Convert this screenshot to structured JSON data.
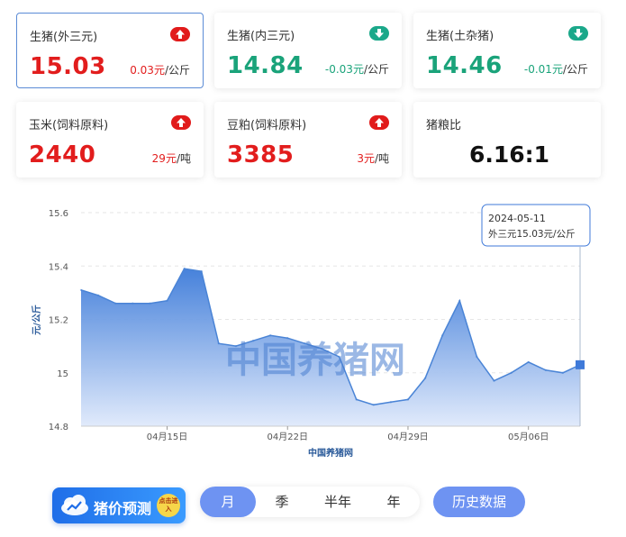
{
  "cards": [
    {
      "title": "生猪(外三元)",
      "price": "15.03",
      "change": "0.03元",
      "unit": "/公斤",
      "trend": "up"
    },
    {
      "title": "生猪(内三元)",
      "price": "14.84",
      "change": "-0.03元",
      "unit": "/公斤",
      "trend": "down"
    },
    {
      "title": "生猪(土杂猪)",
      "price": "14.46",
      "change": "-0.01元",
      "unit": "/公斤",
      "trend": "down"
    },
    {
      "title": "玉米(饲料原料)",
      "price": "2440",
      "change": "29元",
      "unit": "/吨",
      "trend": "up"
    },
    {
      "title": "豆粕(饲料原料)",
      "price": "3385",
      "change": "3元",
      "unit": "/吨",
      "trend": "up"
    },
    {
      "title": "猪粮比",
      "price": "6.16:1"
    }
  ],
  "chart_data": {
    "type": "area",
    "ylabel": "元/公斤",
    "xlabel": "中国养猪网",
    "watermark": "中国养猪网",
    "ylim": [
      14.8,
      15.6
    ],
    "yticks": [
      "15.6",
      "15.4",
      "15.2",
      "15",
      "14.8"
    ],
    "ytick_values": [
      15.6,
      15.4,
      15.2,
      15.0,
      14.8
    ],
    "xticks": [
      {
        "label": "04月15日",
        "index": 5
      },
      {
        "label": "04月22日",
        "index": 12
      },
      {
        "label": "04月29日",
        "index": 19
      },
      {
        "label": "05月06日",
        "index": 26
      }
    ],
    "series": [
      {
        "values": [
          15.31,
          15.29,
          15.26,
          15.26,
          15.26,
          15.27,
          15.39,
          15.38,
          15.11,
          15.1,
          15.12,
          15.14,
          15.13,
          15.11,
          15.09,
          15.06,
          14.9,
          14.88,
          14.89,
          14.9,
          14.98,
          15.14,
          15.27,
          15.06,
          14.97,
          15.0,
          15.04,
          15.01,
          15.0,
          15.03
        ]
      }
    ],
    "tooltip": {
      "date": "2024-05-11",
      "text": "外三元15.03元/公斤"
    },
    "colors": {
      "line": "#4a84d6",
      "fill_top": "#3d7bd9",
      "fill_bottom": "#dfe9fb",
      "marker": "#3f7ad9",
      "grid": "#e6e6e6"
    }
  },
  "forecast": {
    "label": "猪价预测",
    "badge": "点击进入"
  },
  "tabs": [
    "月",
    "季",
    "半年",
    "年"
  ],
  "active_tab": "月",
  "history_label": "历史数据"
}
